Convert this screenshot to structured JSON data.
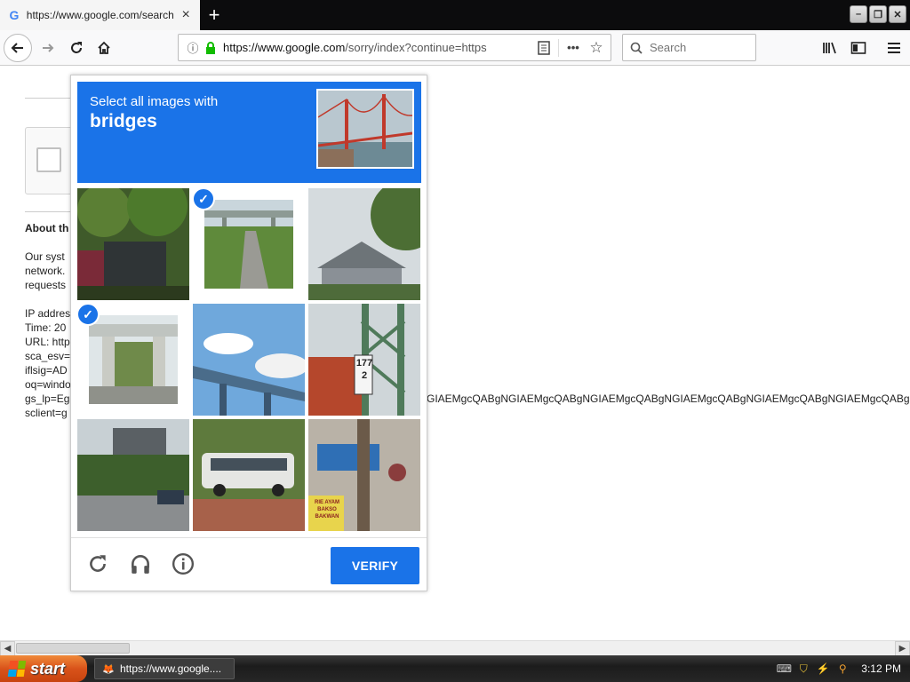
{
  "browser": {
    "tab_title": "https://www.google.com/search?q",
    "url_domain": "https://www.google.com",
    "url_path": "/sorry/index?continue=https",
    "search_placeholder": "Search",
    "new_tab_glyph": "+",
    "tab_close_glyph": "×"
  },
  "page": {
    "heading": "About th",
    "paragraph_lines": [
      "Our syst",
      "network.",
      "requests"
    ],
    "info_lines": [
      "IP addres",
      "Time: 20",
      "URL: http",
      "sca_esv=",
      "iflsig=AD",
      "oq=windo",
      "gs_lp=Eg",
      "sclient=g"
    ],
    "overflow_line": "GIAEMgcQABgNGIAEMgcQABgNGIAEMgcQABgNGIAEMgcQABgNGIAEMgcQABgNGIAEMgcQABgNGIAEMg"
  },
  "captcha": {
    "instruction": "Select all images with",
    "target": "bridges",
    "verify_label": "VERIFY",
    "tiles": [
      {
        "id": "tile-1",
        "scene": "trees-and-building",
        "selected": false
      },
      {
        "id": "tile-2",
        "scene": "overpass-path",
        "selected": true
      },
      {
        "id": "tile-3",
        "scene": "tree-and-roof",
        "selected": false
      },
      {
        "id": "tile-4",
        "scene": "highway-overpass",
        "selected": true
      },
      {
        "id": "tile-5",
        "scene": "sky-and-highway-bridge",
        "selected": false
      },
      {
        "id": "tile-6",
        "scene": "tower-and-sign",
        "selected": false
      },
      {
        "id": "tile-7",
        "scene": "highway-sign",
        "selected": false
      },
      {
        "id": "tile-8",
        "scene": "white-van",
        "selected": false
      },
      {
        "id": "tile-9",
        "scene": "street-market",
        "selected": false
      }
    ],
    "tile_texts": {
      "sign_number": "177\n2",
      "shop_sign": "RIE AYAM\nBAKSO\nBAKWAN"
    },
    "icons": [
      "reload-icon",
      "headphones-icon",
      "info-icon"
    ]
  },
  "taskbar": {
    "start_label": "start",
    "task_label": "https://www.google....",
    "clock": "3:12 PM"
  },
  "colors": {
    "accent": "#1a73e8",
    "start_orange": "#d9531a",
    "lock_green": "#12bc00"
  }
}
